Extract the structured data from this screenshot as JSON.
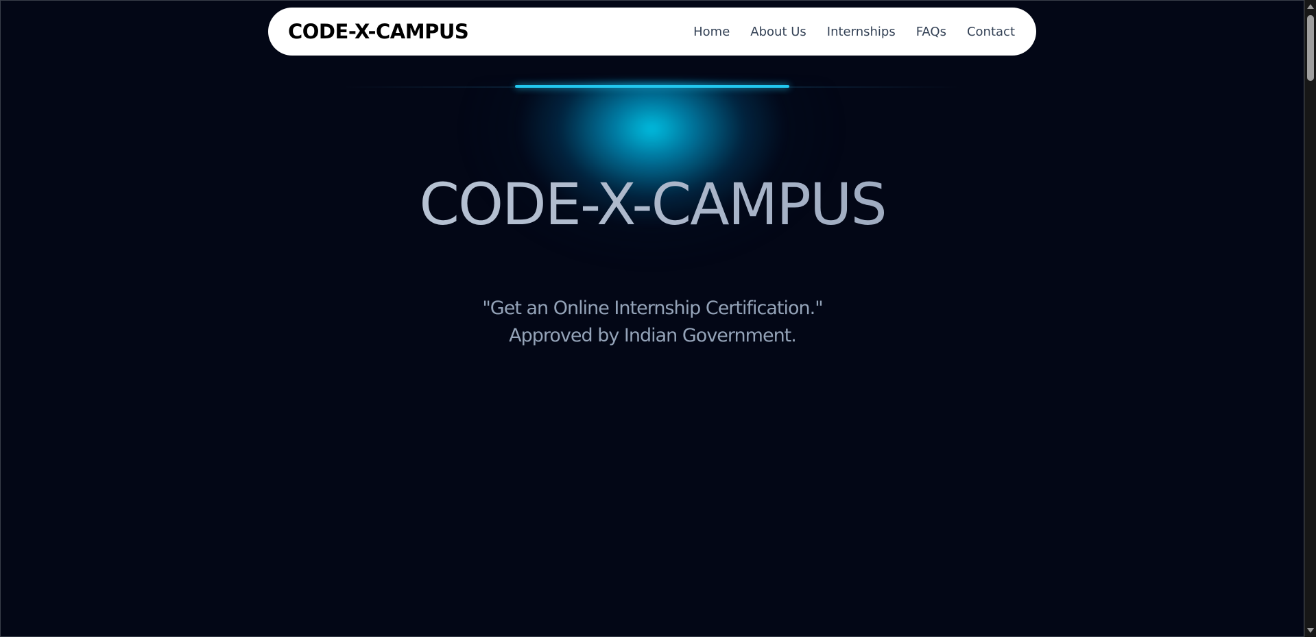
{
  "navbar": {
    "brand": "CODE-X-CAMPUS",
    "links": [
      "Home",
      "About Us",
      "Internships",
      "FAQs",
      "Contact"
    ]
  },
  "hero": {
    "title": "CODE-X-CAMPUS",
    "subtitle_line1": "\"Get an Online Internship Certification.\"",
    "subtitle_line2": "Approved by Indian Government."
  },
  "colors": {
    "background": "#030716",
    "glow": "#00c8eb",
    "navbar_bg": "#ffffff",
    "nav_link": "#334155",
    "title": "#b7c2d4",
    "subtitle": "#94a3b8"
  }
}
